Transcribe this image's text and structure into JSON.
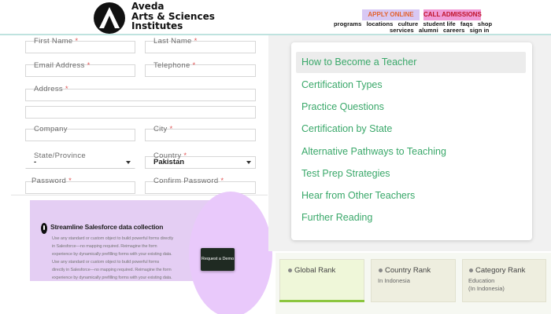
{
  "header": {
    "logo_line1": "Aveda",
    "logo_line2": "Arts & Sciences",
    "logo_line3": "Institutes",
    "apply_label": "APPLY ONLINE",
    "admissions_label": "CALL ADMISSIONS",
    "nav_row1": [
      "programs",
      "locations",
      "culture",
      "student life",
      "faqs",
      "shop"
    ],
    "nav_row2": [
      "services",
      "alumni",
      "careers",
      "sign in"
    ],
    "colors": {
      "apply_bg": "#d8c8f4",
      "apply_text": "#e3622e",
      "admissions_bg": "#f09bd6",
      "admissions_text": "#c0142a",
      "divider": "#bfe3df"
    }
  },
  "form": {
    "first_name_label": "First Name",
    "last_name_label": "Last Name",
    "email_label": "Email Address",
    "telephone_label": "Telephone",
    "address_label": "Address",
    "company_label": "Company",
    "city_label": "City",
    "state_label": "State/Province",
    "state_value": "-",
    "country_label": "Country",
    "country_value": "Pakistan",
    "password_label": "Password",
    "confirm_password_label": "Confirm Password",
    "required_mark": "*"
  },
  "promo": {
    "title": "Streamline Salesforce data collection",
    "body": [
      "Use any standard or custom object to build powerful forms directly",
      "in Salesforce—no mapping required. Reimagine the form",
      "experience by dynamically prefilling forms with your existing data.",
      "Use any standard or custom object to build powerful forms",
      "directly in Salesforce—no mapping required. Reimagine the form",
      "experience by dynamically prefilling forms with your existing data."
    ],
    "cta_label": "Request a Demo",
    "colors": {
      "banner": "#e4cef3",
      "circle": "#e9c9fb",
      "cta_bg": "#1f2a22"
    }
  },
  "menu": {
    "items": [
      "How to Become a Teacher",
      "Certification Types",
      "Practice Questions",
      "Certification by State",
      "Alternative Pathways to Teaching",
      "Test Prep Strategies",
      "Hear from Other Teachers",
      "Further Reading"
    ],
    "active_index": 0,
    "colors": {
      "link": "#3aa86a",
      "active_bg": "#ececec"
    }
  },
  "ranks": {
    "global_title": "Global Rank",
    "country_title": "Country Rank",
    "country_sub": "In Indonesia",
    "category_title": "Category Rank",
    "category_sub1": "Education",
    "category_sub2": "(In Indonesia)",
    "colors": {
      "active_bar": "#8cc63f",
      "box": "#eeeedf"
    }
  }
}
